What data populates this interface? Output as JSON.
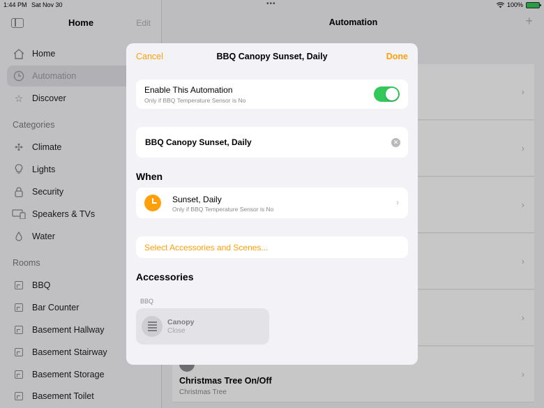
{
  "status_bar": {
    "time": "1:44 PM",
    "date": "Sat Nov 30",
    "battery": "100%"
  },
  "sidebar": {
    "title": "Home",
    "edit_label": "Edit",
    "nav": [
      {
        "label": "Home",
        "icon": "house-icon"
      },
      {
        "label": "Automation",
        "icon": "clock-icon",
        "selected": true
      },
      {
        "label": "Discover",
        "icon": "star-icon"
      }
    ],
    "categories_header": "Categories",
    "categories": [
      {
        "label": "Climate",
        "icon": "fan-icon"
      },
      {
        "label": "Lights",
        "icon": "lightbulb-icon"
      },
      {
        "label": "Security",
        "icon": "lock-icon"
      },
      {
        "label": "Speakers & TVs",
        "icon": "tv-speaker-icon"
      },
      {
        "label": "Water",
        "icon": "water-drop-icon"
      }
    ],
    "rooms_header": "Rooms",
    "rooms": [
      {
        "label": "BBQ"
      },
      {
        "label": "Bar Counter"
      },
      {
        "label": "Basement Hallway"
      },
      {
        "label": "Basement Stairway"
      },
      {
        "label": "Basement Storage"
      },
      {
        "label": "Basement Toilet"
      }
    ]
  },
  "main": {
    "title": "Automation",
    "add_label": "+",
    "visible_automation": {
      "name": "Christmas Tree On/Off",
      "subtitle": "Christmas Tree"
    }
  },
  "modal": {
    "cancel_label": "Cancel",
    "title": "BBQ Canopy Sunset, Daily",
    "done_label": "Done",
    "enable": {
      "label": "Enable This Automation",
      "subtitle": "Only if BBQ Temperature Sensor is No",
      "on": true
    },
    "name_value": "BBQ Canopy Sunset, Daily",
    "when_header": "When",
    "when": {
      "label": "Sunset, Daily",
      "subtitle": "Only if BBQ Temperature Sensor is No"
    },
    "select_label": "Select Accessories and Scenes...",
    "accessories_header": "Accessories",
    "group_label": "BBQ",
    "accessory": {
      "name": "Canopy",
      "state": "Close"
    }
  },
  "colors": {
    "accent": "#ff9f0a",
    "toggle_on": "#34c759"
  }
}
